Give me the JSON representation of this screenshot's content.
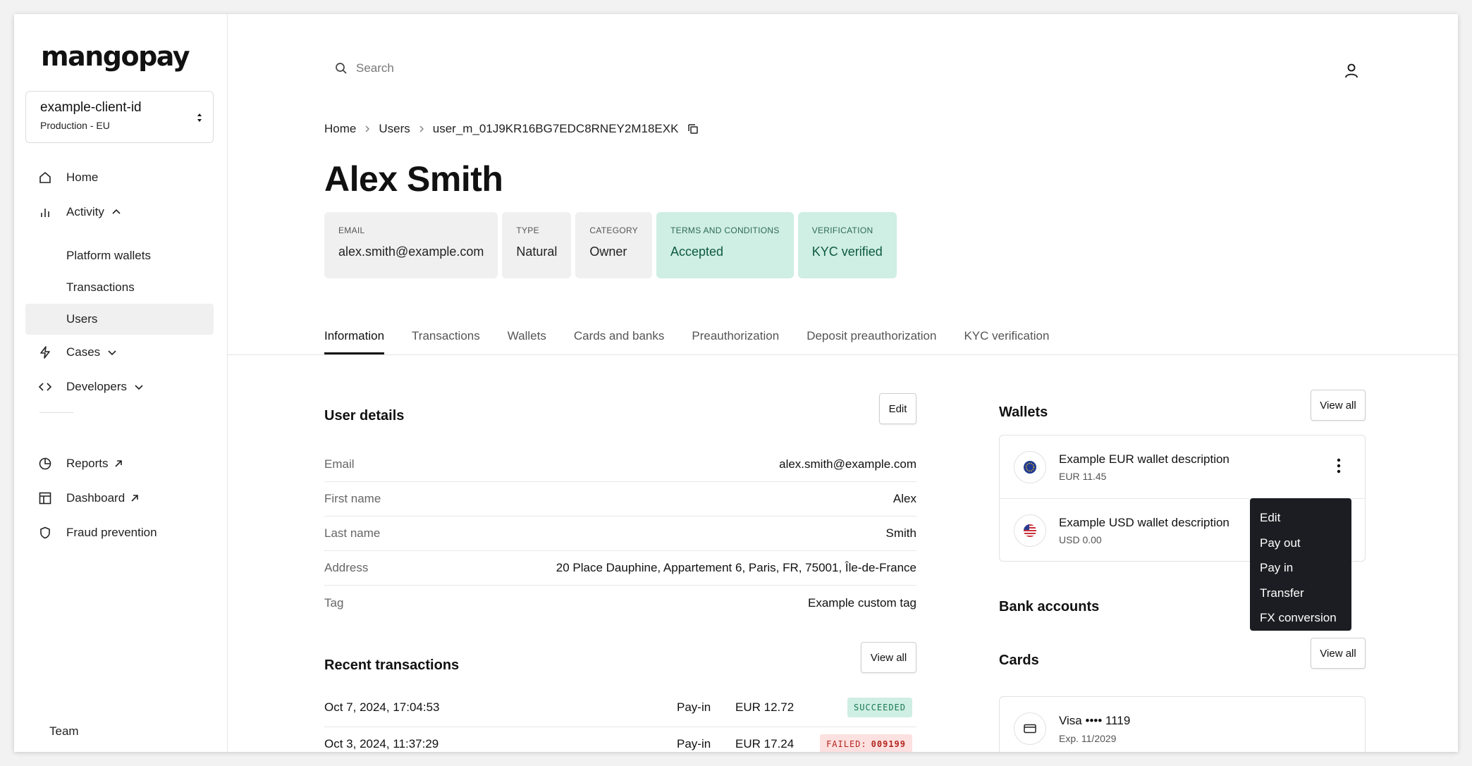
{
  "brand": {
    "logo_text": "mangopay"
  },
  "client": {
    "id": "example-client-id",
    "environment": "Production - EU"
  },
  "sidebar": {
    "items": [
      {
        "label": "Home"
      },
      {
        "label": "Activity"
      },
      {
        "label": "Platform wallets"
      },
      {
        "label": "Transactions"
      },
      {
        "label": "Users"
      },
      {
        "label": "Cases"
      },
      {
        "label": "Developers"
      },
      {
        "label": "Reports"
      },
      {
        "label": "Dashboard"
      },
      {
        "label": "Fraud prevention"
      }
    ],
    "footer": "Team"
  },
  "search": {
    "placeholder": "Search"
  },
  "breadcrumb": [
    "Home",
    "Users",
    "user_m_01J9KR16BG7EDC8RNEY2M18EXK"
  ],
  "user": {
    "name": "Alex Smith"
  },
  "chips": [
    {
      "label": "EMAIL",
      "value": "alex.smith@example.com"
    },
    {
      "label": "TYPE",
      "value": "Natural"
    },
    {
      "label": "CATEGORY",
      "value": "Owner"
    },
    {
      "label": "TERMS AND CONDITIONS",
      "value": "Accepted"
    },
    {
      "label": "VERIFICATION",
      "value": "KYC verified"
    }
  ],
  "tabs": [
    "Information",
    "Transactions",
    "Wallets",
    "Cards and banks",
    "Preauthorization",
    "Deposit preauthorization",
    "KYC verification"
  ],
  "user_details": {
    "title": "User details",
    "edit_label": "Edit",
    "rows": [
      {
        "key": "Email",
        "value": "alex.smith@example.com"
      },
      {
        "key": "First name",
        "value": "Alex"
      },
      {
        "key": "Last name",
        "value": "Smith"
      },
      {
        "key": "Address",
        "value": "20 Place Dauphine, Appartement 6, Paris, FR, 75001, Île-de-France"
      },
      {
        "key": "Tag",
        "value": "Example custom tag"
      }
    ]
  },
  "recent_transactions": {
    "title": "Recent transactions",
    "view_all_label": "View all",
    "rows": [
      {
        "date": "Oct 7, 2024, 17:04:53",
        "type": "Pay-in",
        "amount": "EUR 12.72",
        "status": "SUCCEEDED",
        "code": ""
      },
      {
        "date": "Oct 3, 2024, 11:37:29",
        "type": "Pay-in",
        "amount": "EUR 17.24",
        "status": "FAILED:",
        "code": "009199"
      }
    ]
  },
  "wallets": {
    "title": "Wallets",
    "view_all_label": "View all",
    "items": [
      {
        "description": "Example EUR wallet description",
        "balance": "EUR 11.45"
      },
      {
        "description": "Example USD wallet description",
        "balance": "USD 0.00"
      }
    ]
  },
  "wallet_menu": [
    "Edit",
    "Pay out",
    "Pay in",
    "Transfer",
    "FX conversion"
  ],
  "bank_accounts": {
    "title": "Bank accounts"
  },
  "cards": {
    "title": "Cards",
    "view_all_label": "View all",
    "items": [
      {
        "name": "Visa •••• 1119",
        "expiry": "Exp. 11/2029"
      }
    ]
  },
  "colors": {
    "accent_green_bg": "#cfeee4",
    "accent_green_text": "#0d5a3f",
    "failed_bg": "#fde0e0",
    "failed_text": "#b3261e",
    "menu_bg": "#1c1d22"
  }
}
